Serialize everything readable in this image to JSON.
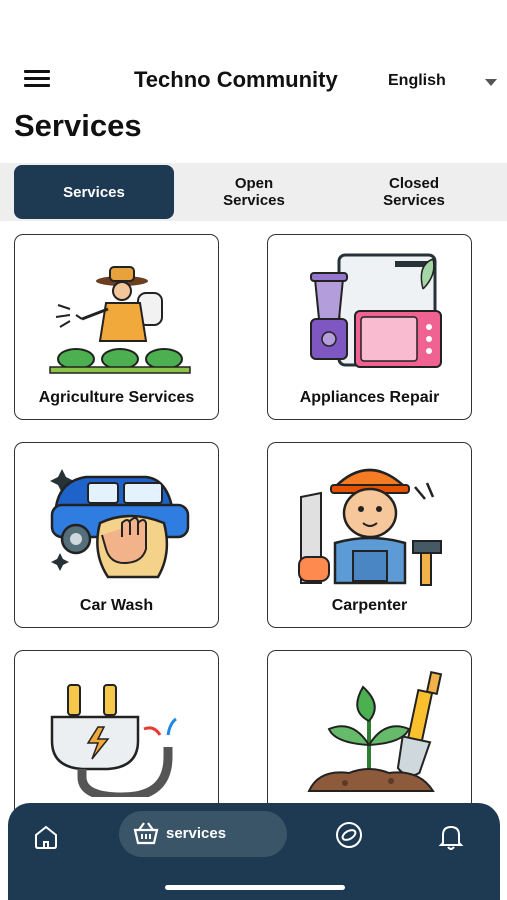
{
  "header": {
    "title": "Techno Community",
    "language": "English",
    "menu_icon": "hamburger-menu-icon",
    "language_caret_icon": "caret-down-icon"
  },
  "page": {
    "title": "Services"
  },
  "tabs": [
    {
      "label": "Services",
      "active": true
    },
    {
      "label": "Open\nServices",
      "active": false
    },
    {
      "label": "Closed\nServices",
      "active": false
    }
  ],
  "services": [
    {
      "label": "Agriculture Services",
      "icon": "farmer-spraying-icon"
    },
    {
      "label": "Appliances Repair",
      "icon": "kitchen-appliances-icon"
    },
    {
      "label": "Car Wash",
      "icon": "car-wash-icon"
    },
    {
      "label": "Carpenter",
      "icon": "carpenter-icon"
    },
    {
      "label": "",
      "icon": "electric-plug-icon"
    },
    {
      "label": "",
      "icon": "plant-shovel-icon"
    }
  ],
  "bottom_nav": {
    "home_icon": "home-icon",
    "services_label": "services",
    "services_icon": "basket-icon",
    "explore_icon": "compass-icon",
    "alerts_icon": "bell-icon"
  },
  "colors": {
    "primary": "#1e3a52",
    "active_pill": "#3a5468",
    "tab_bg": "#eeeeee",
    "card_border": "#333333"
  }
}
